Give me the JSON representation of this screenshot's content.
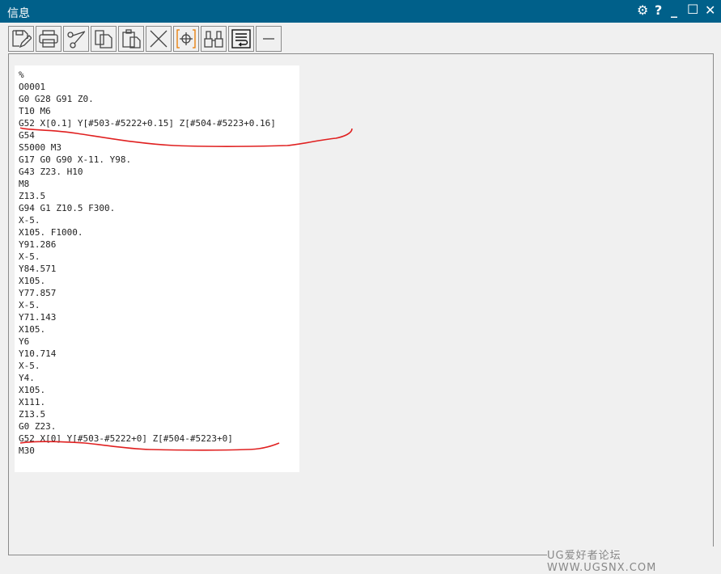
{
  "window": {
    "title": "信息",
    "settings_icon": "gear-icon",
    "help_label": "?",
    "minimize_label": "_",
    "maximize_label": "☐",
    "close_label": "✕"
  },
  "toolbar": {
    "buttons": [
      "save-edit",
      "print",
      "cut",
      "copy",
      "paste",
      "delete",
      "select-point",
      "find",
      "wrap-text",
      "minimize-panel"
    ]
  },
  "lines": [
    "%",
    "O0001",
    "G0 G28 G91 Z0.",
    "T10 M6",
    "G52 X[0.1] Y[#503-#5222+0.15] Z[#504-#5223+0.16]",
    "G54",
    "S5000 M3",
    "G17 G0 G90 X-11. Y98.",
    "G43 Z23. H10",
    "M8",
    "Z13.5",
    "G94 G1 Z10.5 F300.",
    "X-5.",
    "X105. F1000.",
    "Y91.286",
    "X-5.",
    "Y84.571",
    "X105.",
    "Y77.857",
    "X-5.",
    "Y71.143",
    "X105.",
    "Y6",
    "Y10.714",
    "X-5.",
    "Y4.",
    "X105.",
    "X111.",
    "Z13.5",
    "G0 Z23.",
    "G52 X[0] Y[#503-#5222+0] Z[#504-#5223+0]",
    "M30"
  ],
  "watermark": "UG爱好者论坛 WWW.UGSNX.COM",
  "colors": {
    "titlebar": "#00608a",
    "annotation": "#e02020",
    "accent": "#e87a00"
  }
}
